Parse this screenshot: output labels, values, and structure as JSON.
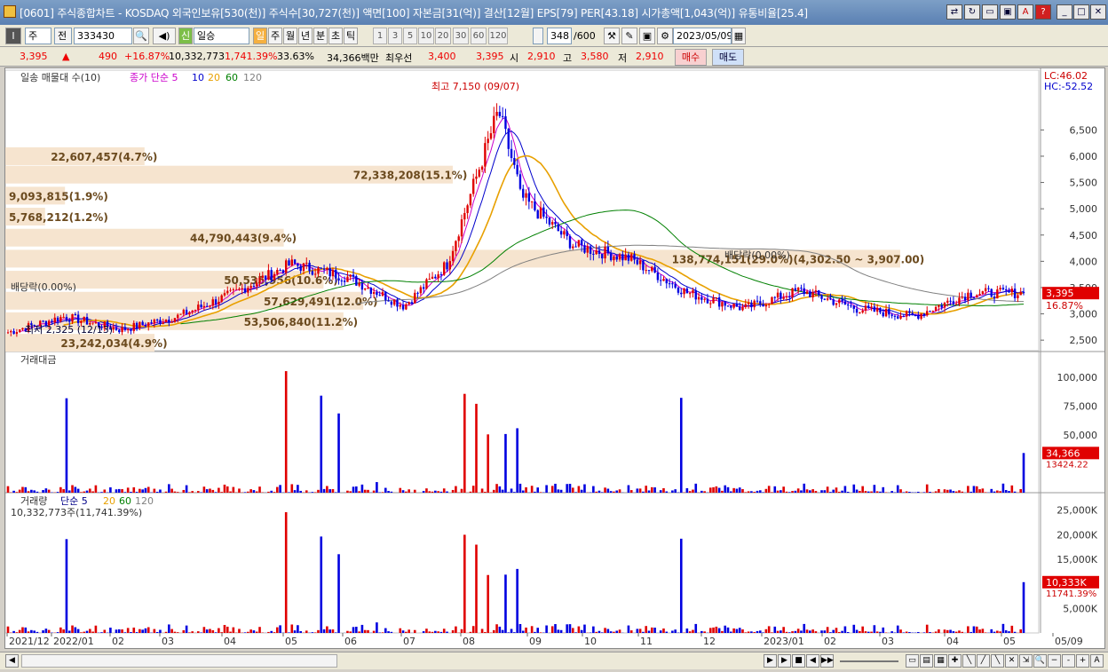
{
  "window": {
    "title": "[0601] 주식종합차트 - KOSDAQ 외국인보유[530(천)] 주식수[30,727(천)] 액면[100] 자본금[31(억)] 결산[12월] EPS[79] PER[43.18] 시가총액[1,043(억)] 유통비율[25.4]"
  },
  "toolbar": {
    "market": "주",
    "prefix": "전",
    "code": "333430",
    "name": "일승",
    "new_badge": "신",
    "periods": [
      "일",
      "주",
      "월",
      "년",
      "분",
      "초",
      "틱"
    ],
    "num_periods": [
      "1",
      "3",
      "5",
      "10",
      "20",
      "30",
      "60",
      "120"
    ],
    "count": "348",
    "count_max": "/600",
    "date": "2023/05/09"
  },
  "quote": {
    "price": "3,395",
    "change": "490",
    "change_pct": "+16.87%",
    "volume": "10,332,773",
    "volume_pct": "1,741.39%",
    "turnover": "33.63%",
    "amount": "34,366백만",
    "best_label": "최우선",
    "best_ask": "3,400",
    "best_bid": "3,395",
    "open_label": "시",
    "open": "2,910",
    "high_label": "고",
    "high": "3,580",
    "low_label": "저",
    "low": "2,910",
    "buy_label": "매수",
    "sell_label": "매도"
  },
  "price_pane": {
    "legend_prefix": "일송 매물대 수(10)",
    "ma_label": "종가 단순 5",
    "ma_periods": [
      "10",
      "20",
      "60",
      "120"
    ],
    "lc": "LC:46.02",
    "hc": "HC:-52.52",
    "current_price_tag": "3,395",
    "current_pct_tag": "16.87%",
    "y_ticks": [
      "6,500",
      "6,000",
      "5,500",
      "5,000",
      "4,500",
      "4,000",
      "3,500",
      "3,000",
      "2,500"
    ],
    "max_label": "최고 7,150 (09/07)",
    "min_label": "최저 2,325 (12/13)",
    "dividend_labels": [
      "배당락(0.00%)",
      "배당락(0.00%)"
    ],
    "volume_profile": [
      {
        "label": "22,607,457(4.7%)",
        "price": 6000,
        "frac": 0.14
      },
      {
        "label": "72,338,208(15.1%)",
        "price": 5650,
        "frac": 0.45
      },
      {
        "label": "9,093,815(1.9%)",
        "price": 5250,
        "frac": 0.06
      },
      {
        "label": "5,768,212(1.2%)",
        "price": 4850,
        "frac": 0.04
      },
      {
        "label": "44,790,443(9.4%)",
        "price": 4450,
        "frac": 0.28
      },
      {
        "label": "138,774,151(29.0%)(4,302.50 ~ 3,907.00)",
        "price": 4050,
        "frac": 0.9
      },
      {
        "label": "50,535,956(10.6%)",
        "price": 3650,
        "frac": 0.32
      },
      {
        "label": "57,629,491(12.0%)",
        "price": 3250,
        "frac": 0.36
      },
      {
        "label": "53,506,840(11.2%)",
        "price": 2860,
        "frac": 0.34
      },
      {
        "label": "23,242,034(4.9%)",
        "price": 2450,
        "frac": 0.15
      }
    ]
  },
  "amount_pane": {
    "title": "거래대금",
    "y_ticks": [
      "100,000",
      "75,000",
      "50,000"
    ],
    "tag": "34,366",
    "tag2": "13424.22"
  },
  "volume_pane": {
    "title": "거래량",
    "ma_label": "단순 5",
    "ma_periods": [
      "20",
      "60",
      "120"
    ],
    "sub": "10,332,773주(11,741.39%)",
    "y_ticks": [
      "25,000K",
      "20,000K",
      "15,000K",
      "10,000K",
      "5,000K"
    ],
    "tag": "10,333K",
    "tag2": "11741.39%"
  },
  "x_axis": [
    "2021/12",
    "2022/01",
    "02",
    "03",
    "04",
    "05",
    "06",
    "07",
    "08",
    "09",
    "10",
    "11",
    "12",
    "2023/01",
    "02",
    "03",
    "04",
    "05",
    "05/09"
  ],
  "chart_data": {
    "type": "candlestick",
    "title": "일승 (333430)",
    "ylim": [
      2300,
      7300
    ],
    "price_months": [
      "2021/12",
      "2022/01",
      "02",
      "03",
      "04",
      "05",
      "06",
      "07",
      "08",
      "09",
      "10",
      "11",
      "12",
      "2023/01",
      "02",
      "03",
      "04",
      "05"
    ],
    "monthly_close": [
      2650,
      2950,
      2700,
      2950,
      3400,
      3950,
      3700,
      3150,
      4200,
      5300,
      4300,
      4050,
      3400,
      3100,
      3450,
      3100,
      2950,
      3395
    ],
    "high": 7150,
    "low": 2325,
    "current": 3395
  }
}
